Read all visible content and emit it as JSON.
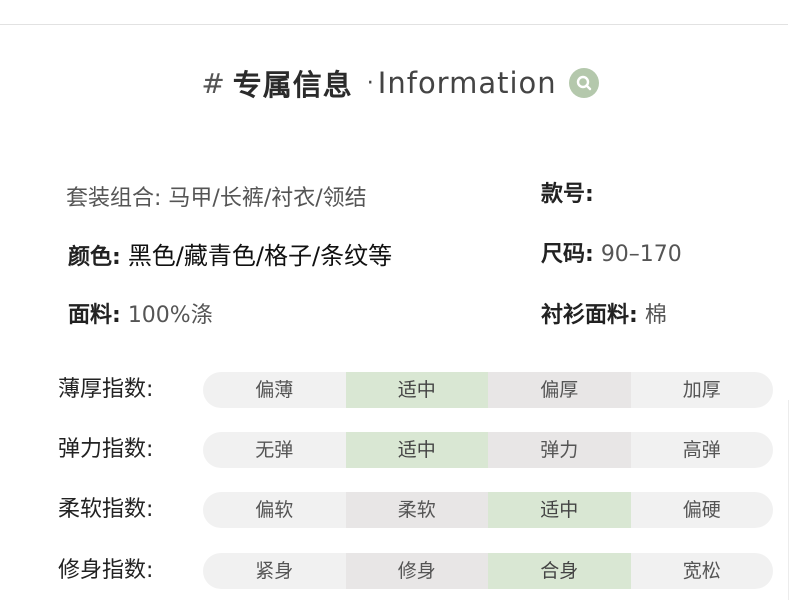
{
  "header": {
    "hash": "#",
    "title_cn": "专属信息",
    "dot": "·",
    "title_en": "Information",
    "icon": "search-icon",
    "icon_color": "#b4c8ac"
  },
  "info": {
    "set": {
      "key": "套装组合:",
      "value": "马甲/长裤/衬衣/领结"
    },
    "style_no": {
      "key": "款号:",
      "value": ""
    },
    "color": {
      "key": "颜色:",
      "value": "黑色/藏青色/格子/条纹等"
    },
    "size": {
      "key": "尺码:",
      "value": "90–170"
    },
    "fabric": {
      "key": "面料:",
      "value": "100%涤"
    },
    "shirt_fabric": {
      "key": "衬衫面料:",
      "value": "棉"
    }
  },
  "scales": [
    {
      "label": "薄厚指数:",
      "options": [
        "偏薄",
        "适中",
        "偏厚",
        "加厚"
      ],
      "selected": 1
    },
    {
      "label": "弹力指数:",
      "options": [
        "无弹",
        "适中",
        "弹力",
        "高弹"
      ],
      "selected": 1
    },
    {
      "label": "柔软指数:",
      "options": [
        "偏软",
        "柔软",
        "适中",
        "偏硬"
      ],
      "selected": 2
    },
    {
      "label": "修身指数:",
      "options": [
        "紧身",
        "修身",
        "合身",
        "宽松"
      ],
      "selected": 2
    }
  ],
  "colors": {
    "selected": "#d9e7d3",
    "track": "#f1f1f1",
    "alt_cell": "#e8e6e6"
  }
}
